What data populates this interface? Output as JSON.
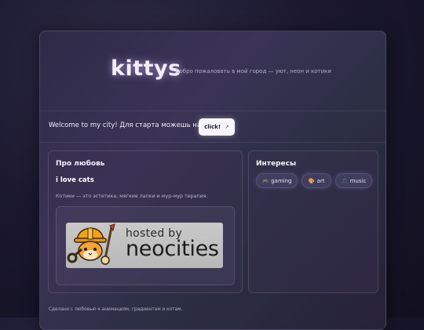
{
  "header": {
    "logo": "kittys",
    "tagline": "Добро пожаловать в мой город — уют, неон и котики"
  },
  "welcome": {
    "text": "Welcome to my city! Для старта можешь нажать:",
    "button_label": "click!",
    "button_icon": "↗"
  },
  "love_panel": {
    "title": "Про любовь",
    "subtitle": "i love cats",
    "description": "Котики — это эстетика, мягкие лапки и мур-мур терапия.",
    "badge": {
      "line1": "hosted by",
      "line2": "neocities"
    }
  },
  "interests_panel": {
    "title": "Интересы",
    "chips": [
      {
        "icon": "🎮",
        "label": "gaming"
      },
      {
        "icon": "🎨",
        "label": "art"
      },
      {
        "icon": "🎵",
        "label": "music"
      }
    ]
  },
  "footer": {
    "text": "Сделано с любовью к анимациям, градиентам и котам."
  },
  "colors": {
    "background": "#1b1830",
    "card": "#342e4d",
    "button": "#f7f5fb",
    "accent_glow": "#d2beff"
  }
}
